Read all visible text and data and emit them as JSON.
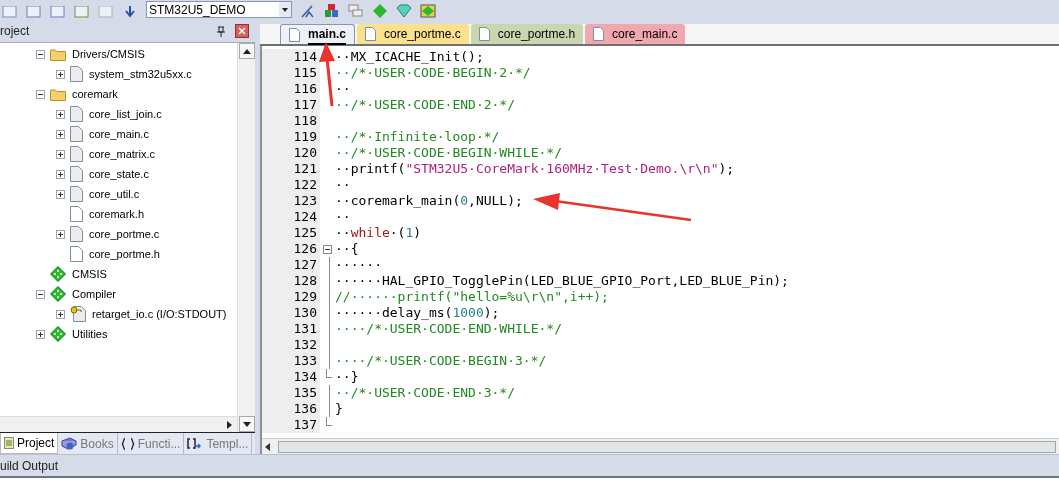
{
  "toolbar": {
    "target": "STM32U5_DEMO"
  },
  "project_panel": {
    "title": "roject",
    "tree": [
      {
        "label": "Drivers/CMSIS",
        "kind": "folder",
        "expanded": true,
        "children": [
          {
            "label": "system_stm32u5xx.c",
            "kind": "file",
            "expanded": false
          }
        ]
      },
      {
        "label": "coremark",
        "kind": "folder",
        "expanded": true,
        "children": [
          {
            "label": "core_list_join.c",
            "kind": "file",
            "expanded": false
          },
          {
            "label": "core_main.c",
            "kind": "file",
            "expanded": false
          },
          {
            "label": "core_matrix.c",
            "kind": "file",
            "expanded": false
          },
          {
            "label": "core_state.c",
            "kind": "file",
            "expanded": false
          },
          {
            "label": "core_util.c",
            "kind": "file",
            "expanded": false
          },
          {
            "label": "coremark.h",
            "kind": "header"
          },
          {
            "label": "core_portme.c",
            "kind": "file",
            "expanded": false
          },
          {
            "label": "core_portme.h",
            "kind": "header"
          }
        ]
      },
      {
        "label": "CMSIS",
        "kind": "component"
      },
      {
        "label": "Compiler",
        "kind": "component",
        "expanded": true,
        "children": [
          {
            "label": "retarget_io.c (I/O:STDOUT)",
            "kind": "config-file",
            "expanded": false
          }
        ]
      },
      {
        "label": "Utilities",
        "kind": "component",
        "expanded": false
      }
    ],
    "tabs": [
      {
        "label": "Project",
        "selected": true,
        "kind": "project"
      },
      {
        "label": "Books",
        "selected": false,
        "kind": "books"
      },
      {
        "label": "Functi...",
        "selected": false,
        "kind": "functions"
      },
      {
        "label": "Templ...",
        "selected": false,
        "kind": "templates"
      }
    ]
  },
  "editor": {
    "tabs": [
      {
        "label": "main.c",
        "selected": true,
        "color": "#eef2f8"
      },
      {
        "label": "core_portme.c",
        "selected": false,
        "color": "#fbe08e"
      },
      {
        "label": "core_portme.h",
        "selected": false,
        "color": "#c9d7ae"
      },
      {
        "label": "core_main.c",
        "selected": false,
        "color": "#f0a7ae"
      }
    ],
    "lines": [
      {
        "number": "114",
        "segments": [
          {
            "kind": "plain",
            "text": "··MX_ICACHE_Init();"
          }
        ]
      },
      {
        "number": "115",
        "segments": [
          {
            "kind": "comment",
            "text": "··/*·USER·CODE·BEGIN·2·*/"
          }
        ]
      },
      {
        "number": "116",
        "segments": [
          {
            "kind": "plain",
            "text": "··"
          }
        ]
      },
      {
        "number": "117",
        "segments": [
          {
            "kind": "comment",
            "text": "··/*·USER·CODE·END·2·*/"
          }
        ]
      },
      {
        "number": "118"
      },
      {
        "number": "119",
        "segments": [
          {
            "kind": "comment",
            "text": "··/*·Infinite·loop·*/"
          }
        ]
      },
      {
        "number": "120",
        "segments": [
          {
            "kind": "comment",
            "text": "··/*·USER·CODE·BEGIN·WHILE·*/"
          }
        ]
      },
      {
        "number": "121",
        "segments": [
          {
            "kind": "plain",
            "text": "··printf("
          },
          {
            "kind": "string",
            "text": "\"STM32U5·CoreMark·160MHz·Test·Demo.\\r\\n\""
          },
          {
            "kind": "plain",
            "text": ");"
          }
        ]
      },
      {
        "number": "122",
        "segments": [
          {
            "kind": "plain",
            "text": "··"
          }
        ]
      },
      {
        "number": "123",
        "segments": [
          {
            "kind": "plain",
            "text": "··coremark_main("
          },
          {
            "kind": "number",
            "text": "0"
          },
          {
            "kind": "plain",
            "text": ",NULL);"
          }
        ]
      },
      {
        "number": "124",
        "segments": [
          {
            "kind": "plain",
            "text": "··"
          }
        ]
      },
      {
        "number": "125",
        "segments": [
          {
            "kind": "plain",
            "text": "··"
          },
          {
            "kind": "keyword",
            "text": "while"
          },
          {
            "kind": "plain",
            "text": "·("
          },
          {
            "kind": "number",
            "text": "1"
          },
          {
            "kind": "plain",
            "text": ")"
          }
        ]
      },
      {
        "number": "126",
        "fold_expanded": true,
        "segments": [
          {
            "kind": "plain",
            "text": "··{"
          }
        ]
      },
      {
        "number": "127",
        "fold_guide": true,
        "segments": [
          {
            "kind": "plain",
            "text": "······"
          }
        ]
      },
      {
        "number": "128",
        "fold_guide": true,
        "segments": [
          {
            "kind": "plain",
            "text": "······HAL_GPIO_TogglePin(LED_BLUE_GPIO_Port,LED_BLUE_Pin);"
          }
        ]
      },
      {
        "number": "129",
        "fold_guide": true,
        "segments": [
          {
            "kind": "comment",
            "text": "//······printf(\"hello=%u\\r\\n\",i++);"
          }
        ]
      },
      {
        "number": "130",
        "fold_guide": true,
        "segments": [
          {
            "kind": "plain",
            "text": "······delay_ms("
          },
          {
            "kind": "number",
            "text": "1000"
          },
          {
            "kind": "plain",
            "text": ");"
          }
        ]
      },
      {
        "number": "131",
        "fold_guide": true,
        "segments": [
          {
            "kind": "comment",
            "text": "····/*·USER·CODE·END·WHILE·*/"
          }
        ]
      },
      {
        "number": "132",
        "fold_guide": true
      },
      {
        "number": "133",
        "fold_guide": true,
        "segments": [
          {
            "kind": "comment",
            "text": "····/*·USER·CODE·BEGIN·3·*/"
          }
        ]
      },
      {
        "number": "134",
        "fold_end": true,
        "segments": [
          {
            "kind": "plain",
            "text": "··}"
          }
        ]
      },
      {
        "number": "135",
        "fold_guide": true,
        "segments": [
          {
            "kind": "comment",
            "text": "··/*·USER·CODE·END·3·*/"
          }
        ]
      },
      {
        "number": "136",
        "fold_guide": true,
        "segments": [
          {
            "kind": "plain",
            "text": "}"
          }
        ]
      },
      {
        "number": "137",
        "fold_end": true
      }
    ]
  },
  "output_panel": {
    "title": "uild Output"
  }
}
